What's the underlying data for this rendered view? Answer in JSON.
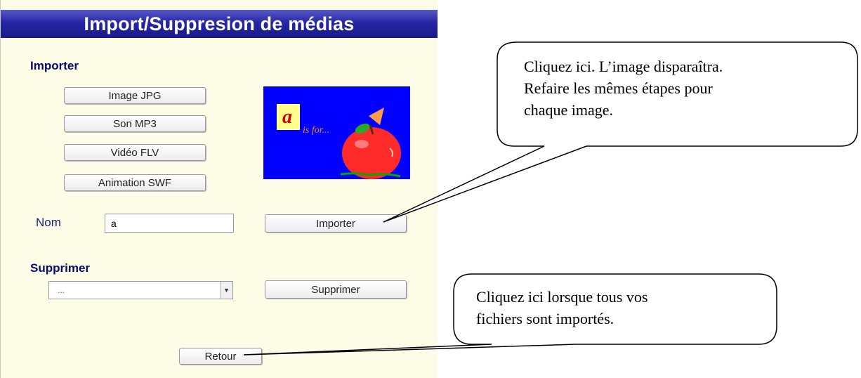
{
  "window": {
    "title": "Import/Suppresion de médias"
  },
  "import_section": {
    "heading": "Importer",
    "type_buttons": [
      "Image JPG",
      "Son MP3",
      "Vidéo FLV",
      "Animation SWF"
    ],
    "name_label": "Nom",
    "name_value": "a",
    "import_button": "Importer"
  },
  "preview": {
    "caption": "is for..."
  },
  "delete_section": {
    "heading": "Supprimer",
    "select_value": "...",
    "delete_button": "Supprimer"
  },
  "back_button": "Retour",
  "callouts": {
    "top": [
      "Cliquez ici.  L’image disparaîtra.",
      "Refaire les mêmes étapes pour",
      "chaque image."
    ],
    "bottom": [
      "Cliquez ici lorsque tous vos",
      "fichiers sont importés."
    ]
  },
  "colors": {
    "title_bar": "#2626a4",
    "panel_bg": "#fdfde7",
    "heading": "#0a0a6e",
    "preview_bg": "#0000ff"
  }
}
